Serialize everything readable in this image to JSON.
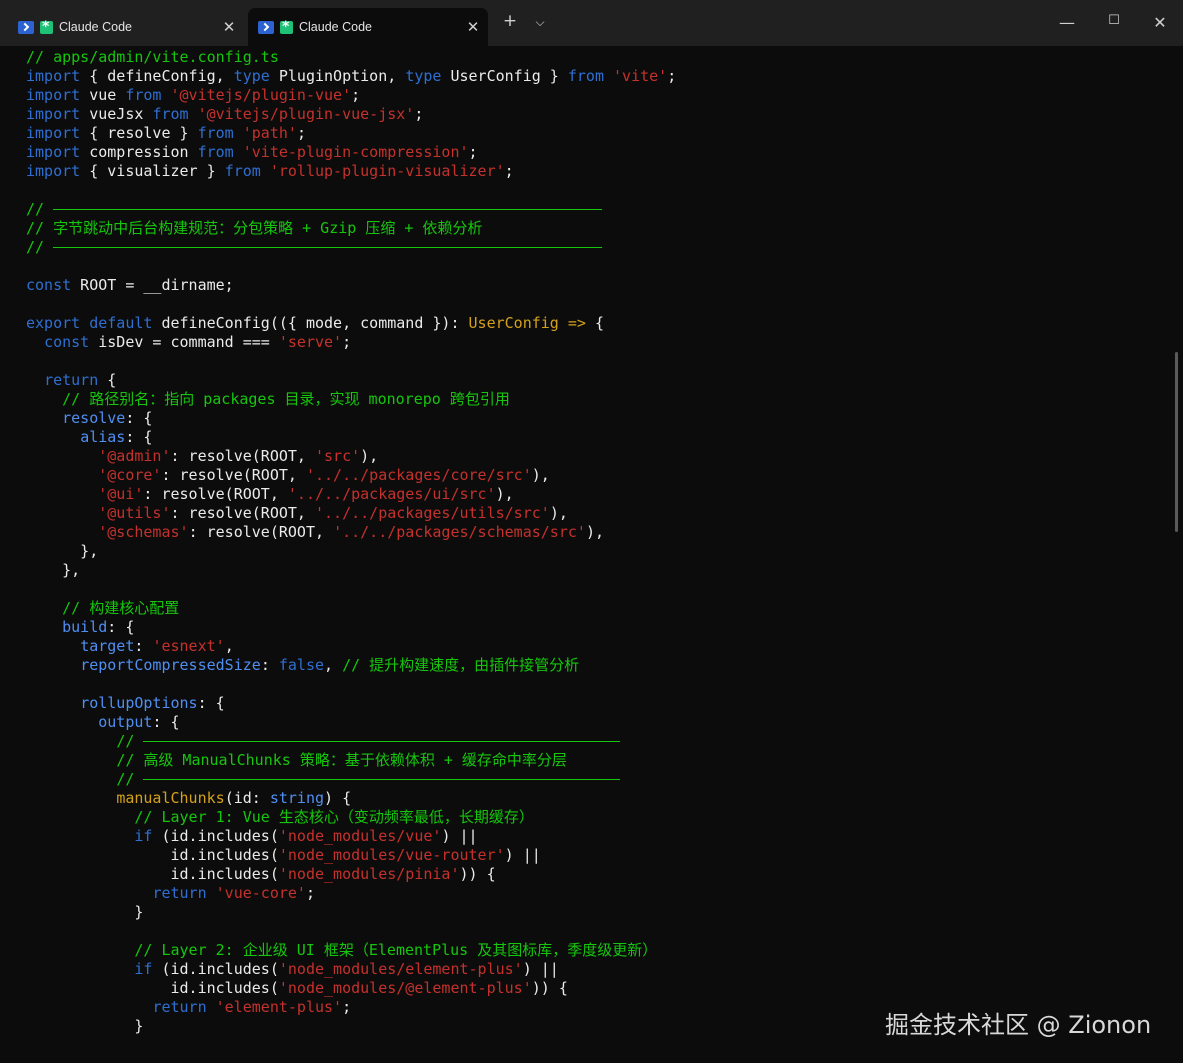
{
  "tabs": [
    {
      "label": "Claude Code",
      "close_label": "✕",
      "active": false
    },
    {
      "label": "Claude Code",
      "close_label": "✕",
      "active": true
    }
  ],
  "window_controls": {
    "new_tab": "+",
    "dropdown": "⌵",
    "minimize": "—",
    "maximize": "☐",
    "close": "✕"
  },
  "colors": {
    "keyword": "#2e6fd1",
    "string": "#c5312c",
    "comment": "#16c60c",
    "type": "#d4a11a",
    "property": "#4f8ff2",
    "plain": "#ebebeb",
    "background": "#0c0c0c"
  },
  "code_lines": [
    [
      [
        "c",
        "// apps/admin/vite.config.ts"
      ]
    ],
    [
      [
        "k",
        "import"
      ],
      [
        "p",
        " { defineConfig, "
      ],
      [
        "k",
        "type"
      ],
      [
        "p",
        " PluginOption, "
      ],
      [
        "k",
        "type"
      ],
      [
        "p",
        " UserConfig } "
      ],
      [
        "k",
        "from"
      ],
      [
        "p",
        " "
      ],
      [
        "s",
        "'vite'"
      ],
      [
        "p",
        ";"
      ]
    ],
    [
      [
        "k",
        "import"
      ],
      [
        "p",
        " vue "
      ],
      [
        "k",
        "from"
      ],
      [
        "p",
        " "
      ],
      [
        "s",
        "'@vitejs/plugin-vue'"
      ],
      [
        "p",
        ";"
      ]
    ],
    [
      [
        "k",
        "import"
      ],
      [
        "p",
        " vueJsx "
      ],
      [
        "k",
        "from"
      ],
      [
        "p",
        " "
      ],
      [
        "s",
        "'@vitejs/plugin-vue-jsx'"
      ],
      [
        "p",
        ";"
      ]
    ],
    [
      [
        "k",
        "import"
      ],
      [
        "p",
        " { resolve } "
      ],
      [
        "k",
        "from"
      ],
      [
        "p",
        " "
      ],
      [
        "s",
        "'path'"
      ],
      [
        "p",
        ";"
      ]
    ],
    [
      [
        "k",
        "import"
      ],
      [
        "p",
        " compression "
      ],
      [
        "k",
        "from"
      ],
      [
        "p",
        " "
      ],
      [
        "s",
        "'vite-plugin-compression'"
      ],
      [
        "p",
        ";"
      ]
    ],
    [
      [
        "k",
        "import"
      ],
      [
        "p",
        " { visualizer } "
      ],
      [
        "k",
        "from"
      ],
      [
        "p",
        " "
      ],
      [
        "s",
        "'rollup-plugin-visualizer'"
      ],
      [
        "p",
        ";"
      ]
    ],
    [],
    [
      [
        "c",
        "//"
      ],
      [
        "rule",
        "549"
      ]
    ],
    [
      [
        "c",
        "// 字节跳动中后台构建规范：分包策略 + Gzip 压缩 + 依赖分析"
      ]
    ],
    [
      [
        "c",
        "//"
      ],
      [
        "rule",
        "549"
      ]
    ],
    [],
    [
      [
        "k",
        "const"
      ],
      [
        "p",
        " ROOT = __dirname;"
      ]
    ],
    [],
    [
      [
        "k",
        "export default"
      ],
      [
        "p",
        " defineConfig(({ mode, command }): "
      ],
      [
        "t",
        "UserConfig"
      ],
      [
        "p",
        " "
      ],
      [
        "t",
        "=>"
      ],
      [
        "p",
        " {"
      ]
    ],
    [
      [
        "p",
        "  "
      ],
      [
        "k",
        "const"
      ],
      [
        "p",
        " isDev = command === "
      ],
      [
        "s",
        "'serve'"
      ],
      [
        "p",
        ";"
      ]
    ],
    [],
    [
      [
        "p",
        "  "
      ],
      [
        "k",
        "return"
      ],
      [
        "p",
        " {"
      ]
    ],
    [
      [
        "p",
        "    "
      ],
      [
        "c",
        "// 路径别名：指向 packages 目录，实现 monorepo 跨包引用"
      ]
    ],
    [
      [
        "p",
        "    "
      ],
      [
        "r",
        "resolve"
      ],
      [
        "p",
        ": {"
      ]
    ],
    [
      [
        "p",
        "      "
      ],
      [
        "r",
        "alias"
      ],
      [
        "p",
        ": {"
      ]
    ],
    [
      [
        "p",
        "        "
      ],
      [
        "s",
        "'@admin'"
      ],
      [
        "p",
        ": resolve(ROOT, "
      ],
      [
        "s",
        "'src'"
      ],
      [
        "p",
        "),"
      ]
    ],
    [
      [
        "p",
        "        "
      ],
      [
        "s",
        "'@core'"
      ],
      [
        "p",
        ": resolve(ROOT, "
      ],
      [
        "s",
        "'../../packages/core/src'"
      ],
      [
        "p",
        "),"
      ]
    ],
    [
      [
        "p",
        "        "
      ],
      [
        "s",
        "'@ui'"
      ],
      [
        "p",
        ": resolve(ROOT, "
      ],
      [
        "s",
        "'../../packages/ui/src'"
      ],
      [
        "p",
        "),"
      ]
    ],
    [
      [
        "p",
        "        "
      ],
      [
        "s",
        "'@utils'"
      ],
      [
        "p",
        ": resolve(ROOT, "
      ],
      [
        "s",
        "'../../packages/utils/src'"
      ],
      [
        "p",
        "),"
      ]
    ],
    [
      [
        "p",
        "        "
      ],
      [
        "s",
        "'@schemas'"
      ],
      [
        "p",
        ": resolve(ROOT, "
      ],
      [
        "s",
        "'../../packages/schemas/src'"
      ],
      [
        "p",
        "),"
      ]
    ],
    [
      [
        "p",
        "      },"
      ]
    ],
    [
      [
        "p",
        "    },"
      ]
    ],
    [],
    [
      [
        "p",
        "    "
      ],
      [
        "c",
        "// 构建核心配置"
      ]
    ],
    [
      [
        "p",
        "    "
      ],
      [
        "r",
        "build"
      ],
      [
        "p",
        ": {"
      ]
    ],
    [
      [
        "p",
        "      "
      ],
      [
        "r",
        "target"
      ],
      [
        "p",
        ": "
      ],
      [
        "s",
        "'esnext'"
      ],
      [
        "p",
        ","
      ]
    ],
    [
      [
        "p",
        "      "
      ],
      [
        "r",
        "reportCompressedSize"
      ],
      [
        "p",
        ": "
      ],
      [
        "k",
        "false"
      ],
      [
        "p",
        ", "
      ],
      [
        "c",
        "// 提升构建速度，由插件接管分析"
      ]
    ],
    [],
    [
      [
        "p",
        "      "
      ],
      [
        "r",
        "rollupOptions"
      ],
      [
        "p",
        ": {"
      ]
    ],
    [
      [
        "p",
        "        "
      ],
      [
        "r",
        "output"
      ],
      [
        "p",
        ": {"
      ]
    ],
    [
      [
        "p",
        "          "
      ],
      [
        "c",
        "//"
      ],
      [
        "rule",
        "477"
      ]
    ],
    [
      [
        "p",
        "          "
      ],
      [
        "c",
        "// 高级 ManualChunks 策略：基于依赖体积 + 缓存命中率分层"
      ]
    ],
    [
      [
        "p",
        "          "
      ],
      [
        "c",
        "//"
      ],
      [
        "rule",
        "477"
      ]
    ],
    [
      [
        "p",
        "          "
      ],
      [
        "t",
        "manualChunks"
      ],
      [
        "p",
        "(id: "
      ],
      [
        "r",
        "string"
      ],
      [
        "p",
        ") {"
      ]
    ],
    [
      [
        "p",
        "            "
      ],
      [
        "c",
        "// Layer 1: Vue 生态核心（变动频率最低，长期缓存）"
      ]
    ],
    [
      [
        "p",
        "            "
      ],
      [
        "k",
        "if"
      ],
      [
        "p",
        " (id.includes("
      ],
      [
        "s",
        "'node_modules/vue'"
      ],
      [
        "p",
        ") ||"
      ]
    ],
    [
      [
        "p",
        "                id.includes("
      ],
      [
        "s",
        "'node_modules/vue-router'"
      ],
      [
        "p",
        ") ||"
      ]
    ],
    [
      [
        "p",
        "                id.includes("
      ],
      [
        "s",
        "'node_modules/pinia'"
      ],
      [
        "p",
        ")) {"
      ]
    ],
    [
      [
        "p",
        "              "
      ],
      [
        "k",
        "return"
      ],
      [
        "p",
        " "
      ],
      [
        "s",
        "'vue-core'"
      ],
      [
        "p",
        ";"
      ]
    ],
    [
      [
        "p",
        "            }"
      ]
    ],
    [],
    [
      [
        "p",
        "            "
      ],
      [
        "c",
        "// Layer 2: 企业级 UI 框架（ElementPlus 及其图标库，季度级更新）"
      ]
    ],
    [
      [
        "p",
        "            "
      ],
      [
        "k",
        "if"
      ],
      [
        "p",
        " (id.includes("
      ],
      [
        "s",
        "'node_modules/element-plus'"
      ],
      [
        "p",
        ") ||"
      ]
    ],
    [
      [
        "p",
        "                id.includes("
      ],
      [
        "s",
        "'node_modules/@element-plus'"
      ],
      [
        "p",
        ")) {"
      ]
    ],
    [
      [
        "p",
        "              "
      ],
      [
        "k",
        "return"
      ],
      [
        "p",
        " "
      ],
      [
        "s",
        "'element-plus'"
      ],
      [
        "p",
        ";"
      ]
    ],
    [
      [
        "p",
        "            }"
      ]
    ]
  ],
  "watermark": "掘金技术社区 @ Zionon"
}
